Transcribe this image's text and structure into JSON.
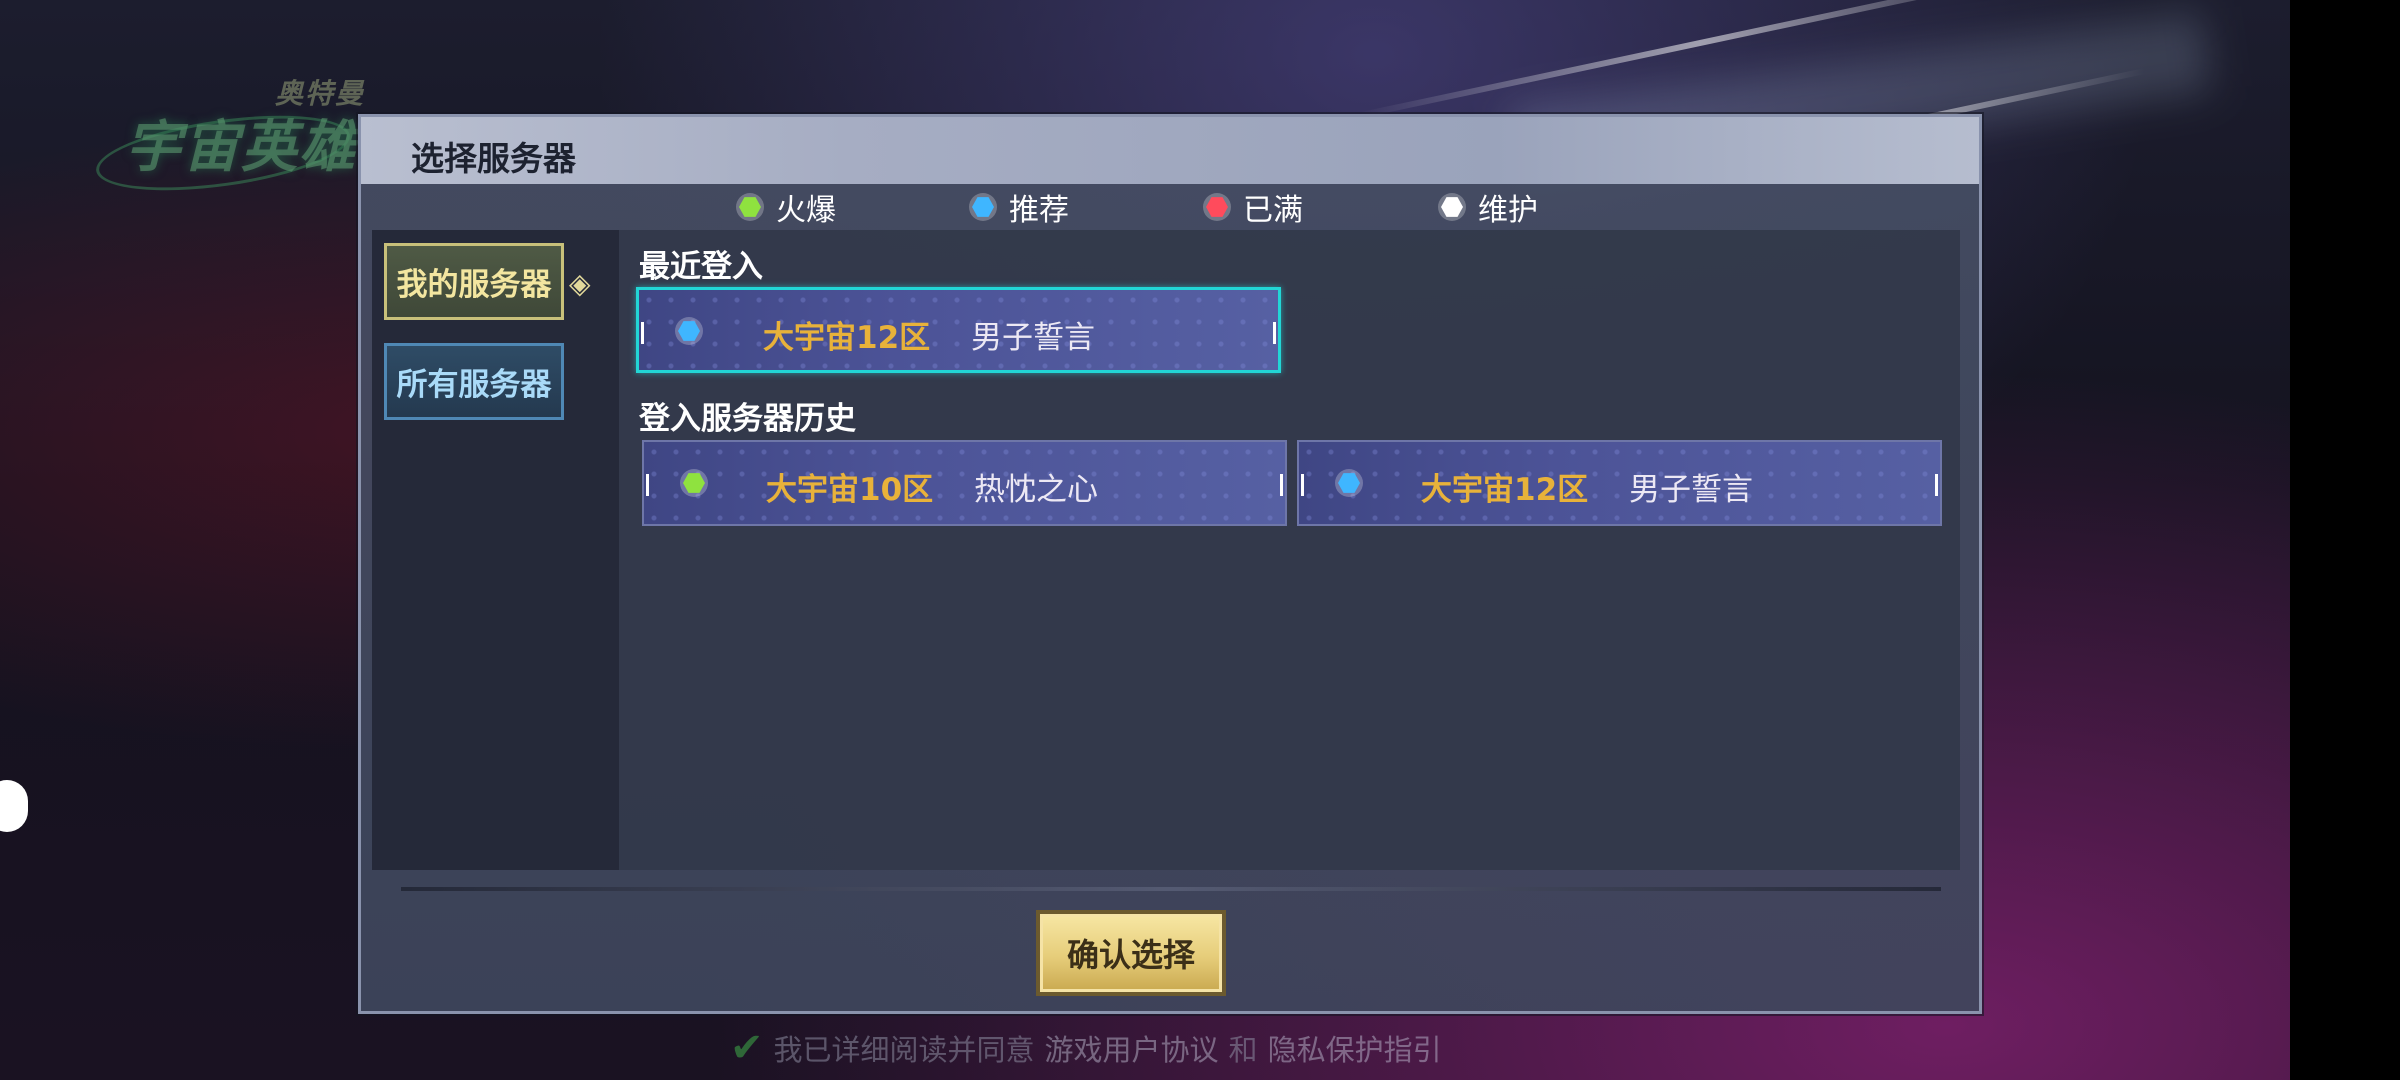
{
  "dialog": {
    "title": "选择服务器",
    "confirm_label": "确认选择"
  },
  "legend": [
    {
      "label": "火爆",
      "color": "#8fe23f"
    },
    {
      "label": "推荐",
      "color": "#3fb6ff"
    },
    {
      "label": "已满",
      "color": "#ff4b5c"
    },
    {
      "label": "维护",
      "color": "#ffffff"
    }
  ],
  "sidebar": {
    "my_servers": "我的服务器",
    "all_servers": "所有服务器"
  },
  "recent": {
    "title": "最近登入",
    "server": {
      "zone": "大宇宙12区",
      "name": "男子誓言",
      "status": "推荐",
      "status_color": "#3fb6ff"
    }
  },
  "history": {
    "title": "登入服务器历史",
    "servers": [
      {
        "zone": "大宇宙10区",
        "name": "热忱之心",
        "status": "火爆",
        "status_color": "#8fe23f"
      },
      {
        "zone": "大宇宙12区",
        "name": "男子誓言",
        "status": "推荐",
        "status_color": "#3fb6ff"
      }
    ]
  },
  "background": {
    "logo_main": "宇宙英雄",
    "logo_sub": "奥特曼",
    "agreement_prefix": "我已详细阅读并同意",
    "agreement_link1": "游戏用户协议",
    "agreement_and": "和",
    "agreement_link2": "隐私保护指引"
  }
}
